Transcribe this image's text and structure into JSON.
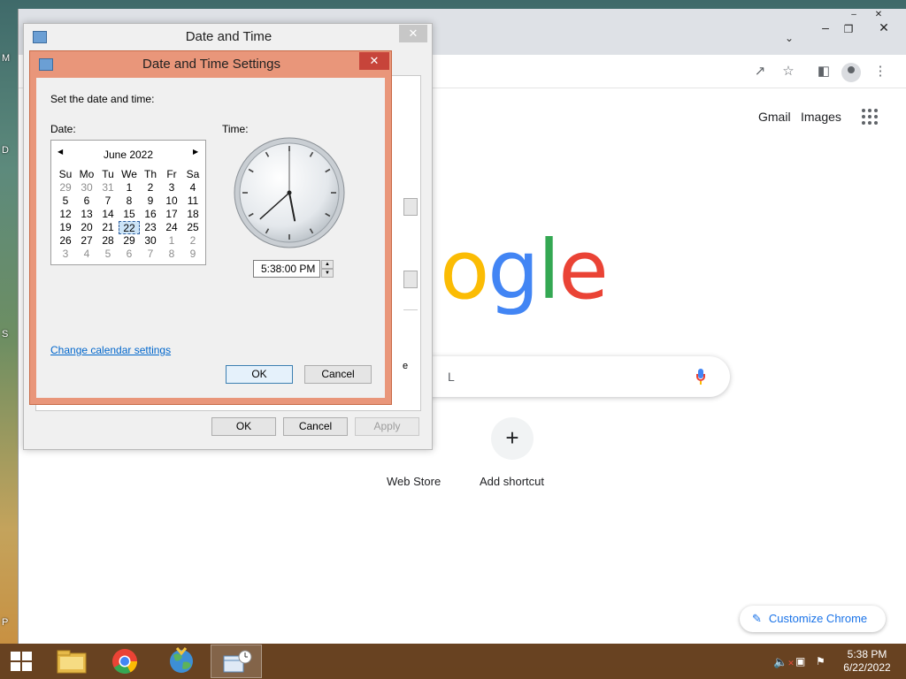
{
  "desktop": {
    "edge_letters": [
      "M",
      "D",
      "S",
      "P"
    ]
  },
  "chrome": {
    "gmail_link": "Gmail",
    "images_link": "Images",
    "search_placeholder": "L",
    "shortcuts": [
      {
        "label": "Web Store"
      },
      {
        "label": "Add shortcut",
        "icon": "+"
      }
    ],
    "customize_label": "Customize Chrome",
    "colors": {
      "blue": "#4285f4",
      "red": "#ea4335",
      "yellow": "#fbbc04",
      "green": "#34a853"
    }
  },
  "date_time_window": {
    "title": "Date and Time",
    "ok": "OK",
    "cancel": "Cancel",
    "apply": "Apply",
    "ghost_letter": "e"
  },
  "settings_dialog": {
    "title": "Date and Time Settings",
    "instruction": "Set the date and time:",
    "date_label": "Date:",
    "time_label": "Time:",
    "calendar": {
      "month_label": "June 2022",
      "day_names": [
        "Su",
        "Mo",
        "Tu",
        "We",
        "Th",
        "Fr",
        "Sa"
      ],
      "weeks": [
        [
          "29",
          "30",
          "31",
          "1",
          "2",
          "3",
          "4"
        ],
        [
          "5",
          "6",
          "7",
          "8",
          "9",
          "10",
          "11"
        ],
        [
          "12",
          "13",
          "14",
          "15",
          "16",
          "17",
          "18"
        ],
        [
          "19",
          "20",
          "21",
          "22",
          "23",
          "24",
          "25"
        ],
        [
          "26",
          "27",
          "28",
          "29",
          "30",
          "1",
          "2"
        ],
        [
          "3",
          "4",
          "5",
          "6",
          "7",
          "8",
          "9"
        ]
      ],
      "selected_day": "22"
    },
    "clock": {
      "hour": 5,
      "minute": 38,
      "second": 0
    },
    "time_value": "5:38:00 PM",
    "change_calendar_link": "Change calendar settings",
    "ok": "OK",
    "cancel": "Cancel"
  },
  "taskbar": {
    "time": "5:38 PM",
    "date": "6/22/2022"
  }
}
